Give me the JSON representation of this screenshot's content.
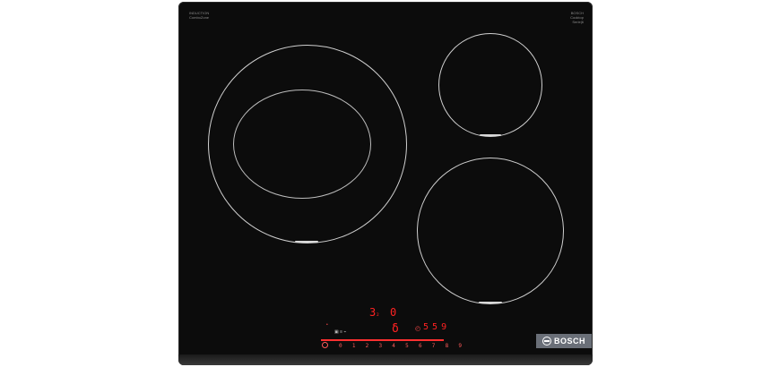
{
  "panel": {
    "brand_top_left": [
      "INDUCTION",
      "ComboZone"
    ],
    "brand_top_right": [
      "BOSCH",
      "Cooktop",
      "Serie|6"
    ],
    "badge_text": "BOSCH"
  },
  "display": {
    "zone_level": "3",
    "zone_level_suffix": "₂",
    "right_level": "0",
    "timer_value": "5 5 9",
    "slider_scale": "0 1 2 3 4 5 6 7 8 9",
    "center_symbol": "δ"
  },
  "colors": {
    "glass": "#0c0c0c",
    "ring": "#cfcfcf",
    "display_red": "#ff2222",
    "badge": "#6a6f78"
  },
  "icons": [
    "power-icon",
    "bosch-logo-icon",
    "timer-icon",
    "lock-icon",
    "function-icons"
  ]
}
